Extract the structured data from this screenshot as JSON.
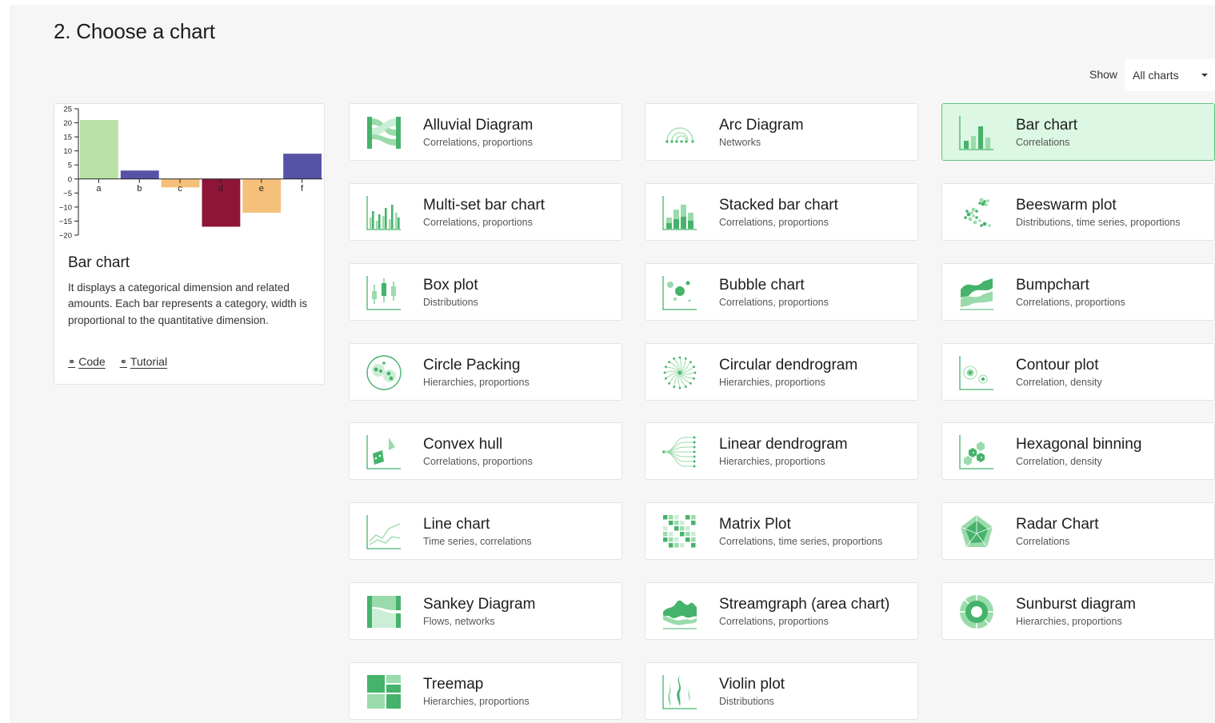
{
  "page": {
    "title": "2. Choose a chart"
  },
  "filter": {
    "show_label": "Show",
    "selected": "All charts"
  },
  "detail": {
    "title": "Bar chart",
    "description": "It displays a categorical dimension and related amounts. Each bar represents a category, width is proportional to the quantitative dimension.",
    "code_link": "Code",
    "tutorial_link": "Tutorial"
  },
  "chart_data": {
    "type": "bar",
    "categories": [
      "a",
      "b",
      "c",
      "d",
      "e",
      "f"
    ],
    "values": [
      21,
      3,
      -3,
      -17,
      -12,
      9
    ],
    "colors": [
      "#b9e0a5",
      "#5653a6",
      "#f5c07a",
      "#8e1538",
      "#f5c07a",
      "#5653a6"
    ],
    "ylim": [
      -20,
      25
    ],
    "yticks": [
      25,
      20,
      15,
      10,
      5,
      0,
      -5,
      -10,
      -15,
      -20
    ],
    "ytick_labels": [
      "25",
      "20",
      "15",
      "10",
      "5",
      "0",
      "−5",
      "−10",
      "−15",
      "−20"
    ]
  },
  "colors": {
    "accent": "#45b36b",
    "accent_light": "#9adbab",
    "selected_bg": "#dcf7e3"
  },
  "cards": [
    {
      "name": "Alluvial Diagram",
      "tags": "Correlations, proportions",
      "icon": "alluvial-icon"
    },
    {
      "name": "Arc Diagram",
      "tags": "Networks",
      "icon": "arc-icon"
    },
    {
      "name": "Bar chart",
      "tags": "Correlations",
      "icon": "bar-icon",
      "selected": true
    },
    {
      "name": "Multi-set bar chart",
      "tags": "Correlations, proportions",
      "icon": "multiset-bar-icon"
    },
    {
      "name": "Stacked bar chart",
      "tags": "Correlations, proportions",
      "icon": "stacked-bar-icon"
    },
    {
      "name": "Beeswarm plot",
      "tags": "Distributions, time series, proportions",
      "icon": "beeswarm-icon"
    },
    {
      "name": "Box plot",
      "tags": "Distributions",
      "icon": "boxplot-icon"
    },
    {
      "name": "Bubble chart",
      "tags": "Correlations, proportions",
      "icon": "bubble-icon"
    },
    {
      "name": "Bumpchart",
      "tags": "Correlations, proportions",
      "icon": "bumpchart-icon"
    },
    {
      "name": "Circle Packing",
      "tags": "Hierarchies, proportions",
      "icon": "circle-packing-icon"
    },
    {
      "name": "Circular dendrogram",
      "tags": "Hierarchies, proportions",
      "icon": "circular-dendrogram-icon"
    },
    {
      "name": "Contour plot",
      "tags": "Correlation, density",
      "icon": "contour-icon"
    },
    {
      "name": "Convex hull",
      "tags": "Correlations, proportions",
      "icon": "convex-hull-icon"
    },
    {
      "name": "Linear dendrogram",
      "tags": "Hierarchies, proportions",
      "icon": "linear-dendrogram-icon"
    },
    {
      "name": "Hexagonal binning",
      "tags": "Correlation, density",
      "icon": "hexbin-icon"
    },
    {
      "name": "Line chart",
      "tags": "Time series, correlations",
      "icon": "line-icon"
    },
    {
      "name": "Matrix Plot",
      "tags": "Correlations, time series, proportions",
      "icon": "matrix-icon"
    },
    {
      "name": "Radar Chart",
      "tags": "Correlations",
      "icon": "radar-icon"
    },
    {
      "name": "Sankey Diagram",
      "tags": "Flows, networks",
      "icon": "sankey-icon"
    },
    {
      "name": "Streamgraph (area chart)",
      "tags": "Correlations, proportions",
      "icon": "streamgraph-icon"
    },
    {
      "name": "Sunburst diagram",
      "tags": "Hierarchies, proportions",
      "icon": "sunburst-icon"
    },
    {
      "name": "Treemap",
      "tags": "Hierarchies, proportions",
      "icon": "treemap-icon"
    },
    {
      "name": "Violin plot",
      "tags": "Distributions",
      "icon": "violin-icon"
    }
  ]
}
